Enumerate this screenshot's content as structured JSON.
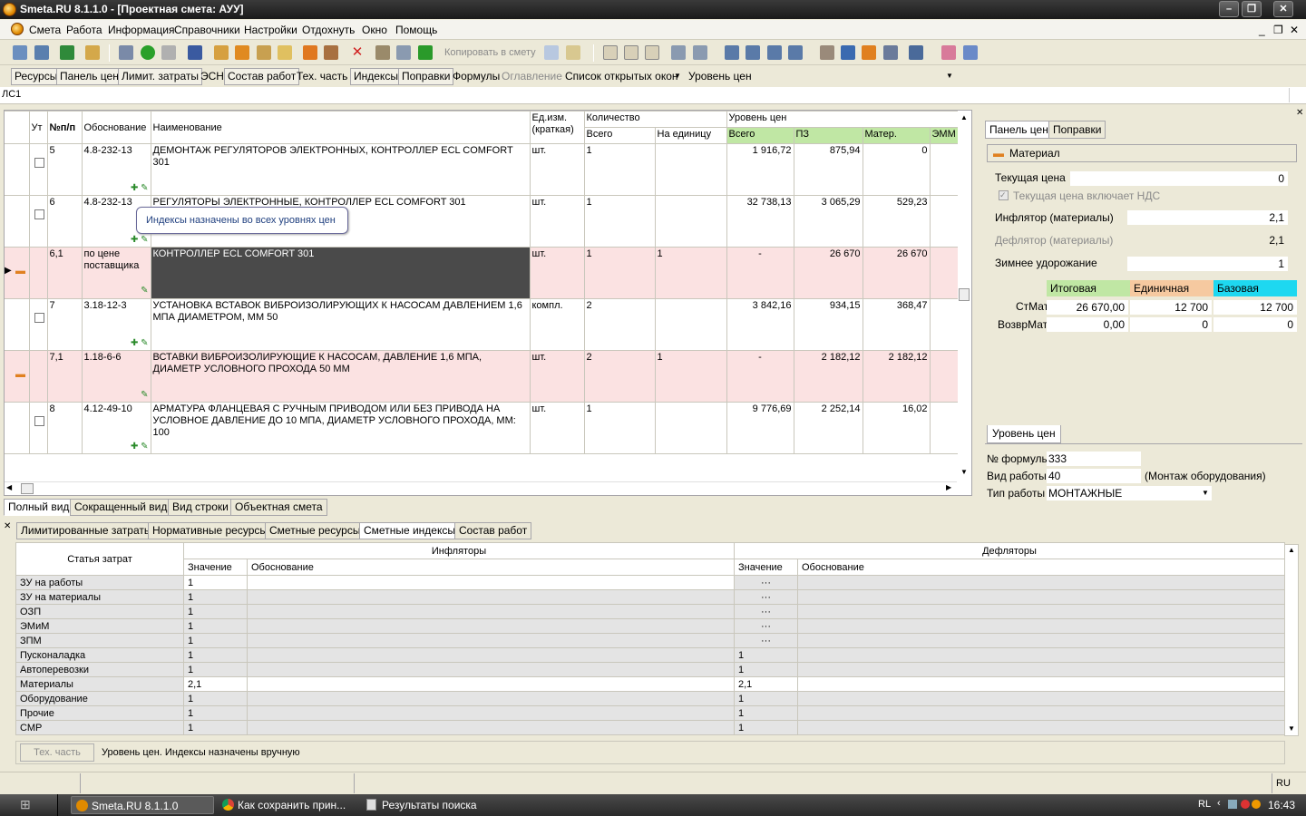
{
  "window": {
    "title": "Smeta.RU  8.1.1.0  - [Проектная смета: АУУ]"
  },
  "menu": [
    "Смета",
    "Работа",
    "Информация",
    "Справочники",
    "Настройки",
    "Отдохнуть",
    "Окно",
    "Помощь"
  ],
  "toolbar": {
    "copy_label": "Копировать в смету"
  },
  "tabs2": [
    "Ресурсы",
    "Панель цен",
    "Лимит. затраты",
    "ЭСН",
    "Состав работ",
    "Тех. часть",
    "Индексы",
    "Поправки",
    "Формулы",
    "Оглавление",
    "Список открытых окон",
    "Уровень цен"
  ],
  "doc_code": "ЛС1",
  "grid": {
    "headers": {
      "ut": "Ут",
      "npp": "№п/п",
      "obosn": "Обоснование",
      "name": "Наименование",
      "unit": "Ед.изм. (краткая)",
      "qty": "Количество",
      "qty_total": "Всего",
      "qty_unit": "На единицу",
      "price": "Уровень цен",
      "p_total": "Всего",
      "p_pz": "ПЗ",
      "p_mat": "Матер.",
      "p_emm": "ЭММ"
    },
    "rows": [
      {
        "n": "5",
        "code": "4.8-232-13",
        "name": "ДЕМОНТАЖ РЕГУЛЯТОРОВ ЭЛЕКТРОННЫХ, КОНТРОЛЛЕР ECL COMFORT 301",
        "unit": "шт.",
        "qty": "1",
        "per": "",
        "total": "1 916,72",
        "pz": "875,94",
        "mat": "0"
      },
      {
        "n": "6",
        "code": "4.8-232-13",
        "name": "РЕГУЛЯТОРЫ ЭЛЕКТРОННЫЕ, КОНТРОЛЛЕР ECL COMFORT 301",
        "unit": "шт.",
        "qty": "1",
        "per": "",
        "total": "32 738,13",
        "pz": "3 065,29",
        "mat": "529,23"
      },
      {
        "n": "6,1",
        "code": "по цене поставщика",
        "name": "КОНТРОЛЛЕР ECL COMFORT 301",
        "unit": "шт.",
        "qty": "1",
        "per": "1",
        "total": "-",
        "pz": "26 670",
        "mat": "26 670"
      },
      {
        "n": "7",
        "code": "3.18-12-3",
        "name": "УСТАНОВКА ВСТАВОК ВИБРОИЗОЛИРУЮЩИХ К НАСОСАМ ДАВЛЕНИЕМ 1,6 МПА ДИАМЕТРОМ, ММ 50",
        "unit": "компл.",
        "qty": "2",
        "per": "",
        "total": "3 842,16",
        "pz": "934,15",
        "mat": "368,47"
      },
      {
        "n": "7,1",
        "code": "1.18-6-6",
        "name": "ВСТАВКИ ВИБРОИЗОЛИРУЮЩИЕ К НАСОСАМ, ДАВЛЕНИЕ 1,6 МПА, ДИАМЕТР УСЛОВНОГО ПРОХОДА 50 ММ",
        "unit": "шт.",
        "qty": "2",
        "per": "1",
        "total": "-",
        "pz": "2 182,12",
        "mat": "2 182,12"
      },
      {
        "n": "8",
        "code": "4.12-49-10",
        "name": "АРМАТУРА ФЛАНЦЕВАЯ С РУЧНЫМ ПРИВОДОМ ИЛИ БЕЗ ПРИВОДА НА УСЛОВНОЕ ДАВЛЕНИЕ ДО 10 МПА, ДИАМЕТР УСЛОВНОГО ПРОХОДА, ММ: 100",
        "unit": "шт.",
        "qty": "1",
        "per": "",
        "total": "9 776,69",
        "pz": "2 252,14",
        "mat": "16,02"
      }
    ],
    "tooltip": "Индексы назначены во всех уровнях цен"
  },
  "view_tabs": [
    "Полный вид",
    "Сокращенный вид",
    "Вид строки",
    "Объектная смета"
  ],
  "right_panel": {
    "tabs": [
      "Панель цен",
      "Поправки"
    ],
    "header": "Материал",
    "current_price_label": "Текущая цена",
    "current_price": "0",
    "vat_label": "Текущая цена включает НДС",
    "inflator_label": "Инфлятор (материалы)",
    "inflator": "2,1",
    "deflator_label": "Дефлятор (материалы)",
    "deflator": "2,1",
    "winter_label": "Зимнее удорожание",
    "winter": "1",
    "cols": [
      "Итоговая",
      "Единичная",
      "Базовая"
    ],
    "stmat_label": "СтМат",
    "stmat": [
      "26 670,00",
      "12 700",
      "12 700"
    ],
    "vozvr_label": "ВозврМат",
    "vozvr": [
      "0,00",
      "0",
      "0"
    ],
    "level_tab": "Уровень цен",
    "formula_label": "№ формулы",
    "formula": "333",
    "work_kind_label": "Вид работы",
    "work_kind": "40",
    "work_kind_desc": "(Монтаж оборудования)",
    "work_type_label": "Тип работы",
    "work_type": "МОНТАЖНЫЕ"
  },
  "bottom": {
    "tabs": [
      "Лимитированные затраты",
      "Нормативные ресурсы",
      "Сметные ресурсы",
      "Сметные индексы",
      "Состав работ"
    ],
    "headers": {
      "item": "Статья затрат",
      "infl": "Инфляторы",
      "defl": "Дефляторы",
      "val": "Значение",
      "osn": "Обоснование"
    },
    "rows": [
      {
        "name": "ЗУ на работы",
        "iv": "1",
        "dv": "···"
      },
      {
        "name": "ЗУ на материалы",
        "iv": "1",
        "dv": "···"
      },
      {
        "name": "ОЗП",
        "iv": "1",
        "dv": "···"
      },
      {
        "name": "ЭМиМ",
        "iv": "1",
        "dv": "···"
      },
      {
        "name": "ЗПМ",
        "iv": "1",
        "dv": "···"
      },
      {
        "name": "Пусконаладка",
        "iv": "1",
        "dv": "1"
      },
      {
        "name": "Автоперевозки",
        "iv": "1",
        "dv": "1"
      },
      {
        "name": "Материалы",
        "iv": "2,1",
        "dv": "2,1"
      },
      {
        "name": "Оборудование",
        "iv": "1",
        "dv": "1"
      },
      {
        "name": "Прочие",
        "iv": "1",
        "dv": "1"
      },
      {
        "name": "СМР",
        "iv": "1",
        "dv": "1"
      }
    ],
    "tech_btn": "Тех. часть",
    "note": "Уровень цен. Индексы назначены вручную"
  },
  "statusbar": {
    "lang": "RU"
  },
  "taskbar": {
    "items": [
      "Smeta.RU  8.1.1.0",
      "Как сохранить прин...",
      "Результаты поиска"
    ],
    "lang": "RL",
    "clock": "16:43"
  }
}
